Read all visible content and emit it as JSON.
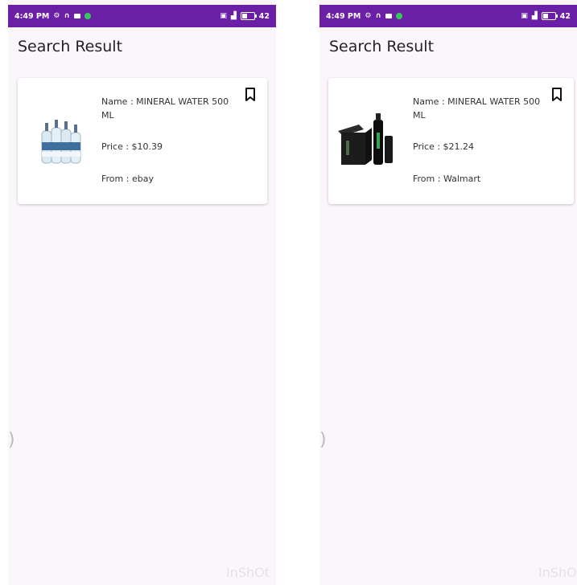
{
  "screens": [
    {
      "status": {
        "time": "4:49 PM",
        "battery": "42"
      },
      "title": "Search Result",
      "result": {
        "name": "Name : MINERAL WATER 500 ML",
        "price": "Price : $10.39",
        "from": "From : ebay",
        "image": "water-bottle-pack-image"
      },
      "watermark": "InShOt"
    },
    {
      "status": {
        "time": "4:49 PM",
        "battery": "42"
      },
      "title": "Search Result",
      "result": {
        "name": "Name : MINERAL WATER 500 ML",
        "price": "Price : $21.24",
        "from": "From : Walmart",
        "image": "black-water-bottle-box-image"
      },
      "watermark": "InShOt"
    }
  ],
  "colors": {
    "status_bar": "#6a1fa6",
    "background": "#fbf6fb",
    "card": "#ffffff",
    "text": "#333333"
  },
  "icons": {
    "bookmark": "bookmark-icon",
    "whatsapp": "whatsapp-icon",
    "video": "video-icon",
    "headset": "headset-icon",
    "wifi": "wifi-icon",
    "signal": "signal-icon",
    "battery": "battery-icon"
  }
}
